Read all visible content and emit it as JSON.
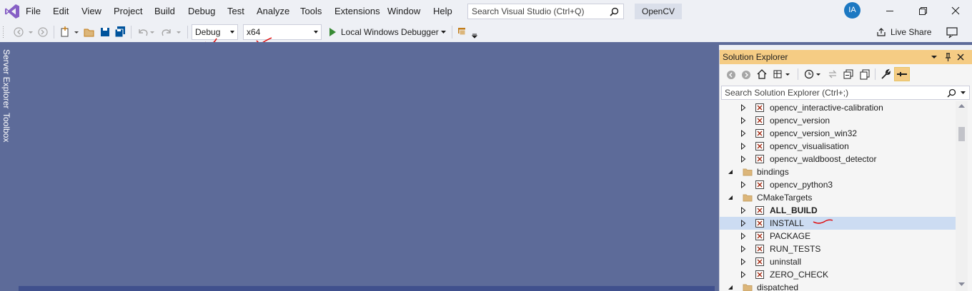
{
  "menu": [
    "File",
    "Edit",
    "View",
    "Project",
    "Build",
    "Debug",
    "Test",
    "Analyze",
    "Tools",
    "Extensions",
    "Window",
    "Help"
  ],
  "search": {
    "placeholder": "Search Visual Studio (Ctrl+Q)"
  },
  "project_name": "OpenCV",
  "user_initials": "IA",
  "toolbar": {
    "config": "Debug",
    "platform": "x64",
    "debugger": "Local Windows Debugger",
    "live_share": "Live Share"
  },
  "side_tabs": [
    "Server Explorer",
    "Toolbox"
  ],
  "solution_explorer": {
    "title": "Solution Explorer",
    "search_placeholder": "Search Solution Explorer (Ctrl+;)",
    "rows": [
      {
        "label": "opencv_interactive-calibration",
        "type": "project",
        "state": "collapsed"
      },
      {
        "label": "opencv_version",
        "type": "project",
        "state": "collapsed"
      },
      {
        "label": "opencv_version_win32",
        "type": "project",
        "state": "collapsed"
      },
      {
        "label": "opencv_visualisation",
        "type": "project",
        "state": "collapsed"
      },
      {
        "label": "opencv_waldboost_detector",
        "type": "project",
        "state": "collapsed"
      },
      {
        "label": "bindings",
        "type": "folder",
        "state": "expanded"
      },
      {
        "label": "opencv_python3",
        "type": "project",
        "state": "collapsed"
      },
      {
        "label": "CMakeTargets",
        "type": "folder",
        "state": "expanded"
      },
      {
        "label": "ALL_BUILD",
        "type": "project",
        "state": "collapsed",
        "bold": true
      },
      {
        "label": "INSTALL",
        "type": "project",
        "state": "collapsed",
        "selected": true
      },
      {
        "label": "PACKAGE",
        "type": "project",
        "state": "collapsed"
      },
      {
        "label": "RUN_TESTS",
        "type": "project",
        "state": "collapsed"
      },
      {
        "label": "uninstall",
        "type": "project",
        "state": "collapsed"
      },
      {
        "label": "ZERO_CHECK",
        "type": "project",
        "state": "collapsed"
      },
      {
        "label": "dispatched",
        "type": "folder",
        "state": "expanded"
      }
    ]
  },
  "colors": {
    "editor_bg": "#5d6b99",
    "accent": "#1c78c2",
    "panel_header": "#f5cc84",
    "annotation": "#e00000"
  }
}
